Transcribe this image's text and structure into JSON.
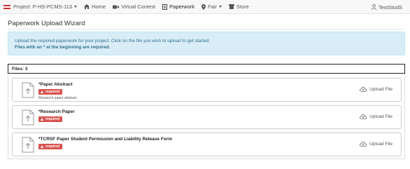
{
  "nav": {
    "project": "Project: P-HS-PCMS-113",
    "home": "Home",
    "virtual_contest": "Virtual Contest",
    "paperwork": "Paperwork",
    "fair": "Fair",
    "store": "Store",
    "user": "TestStudS"
  },
  "page": {
    "title": "Paperwork Upload Wizard"
  },
  "info": {
    "line1": "Upload the required paperwork for your project. Click on the file you wish to upload to get started.",
    "line2": "Files with an * at the beginning are required."
  },
  "files": {
    "header": "Files: 3",
    "badge_label": "required",
    "upload_label": "Upload File",
    "items": [
      {
        "name": "*Paper Abstract",
        "desc": "Research paper abstract"
      },
      {
        "name": "*Research Paper"
      },
      {
        "name": "*TCRSF Paper Student Permission and Liability Release Form"
      }
    ]
  },
  "colors": {
    "info_bg": "#d9edf7",
    "info_text": "#31708f",
    "badge": "#d9534f"
  }
}
